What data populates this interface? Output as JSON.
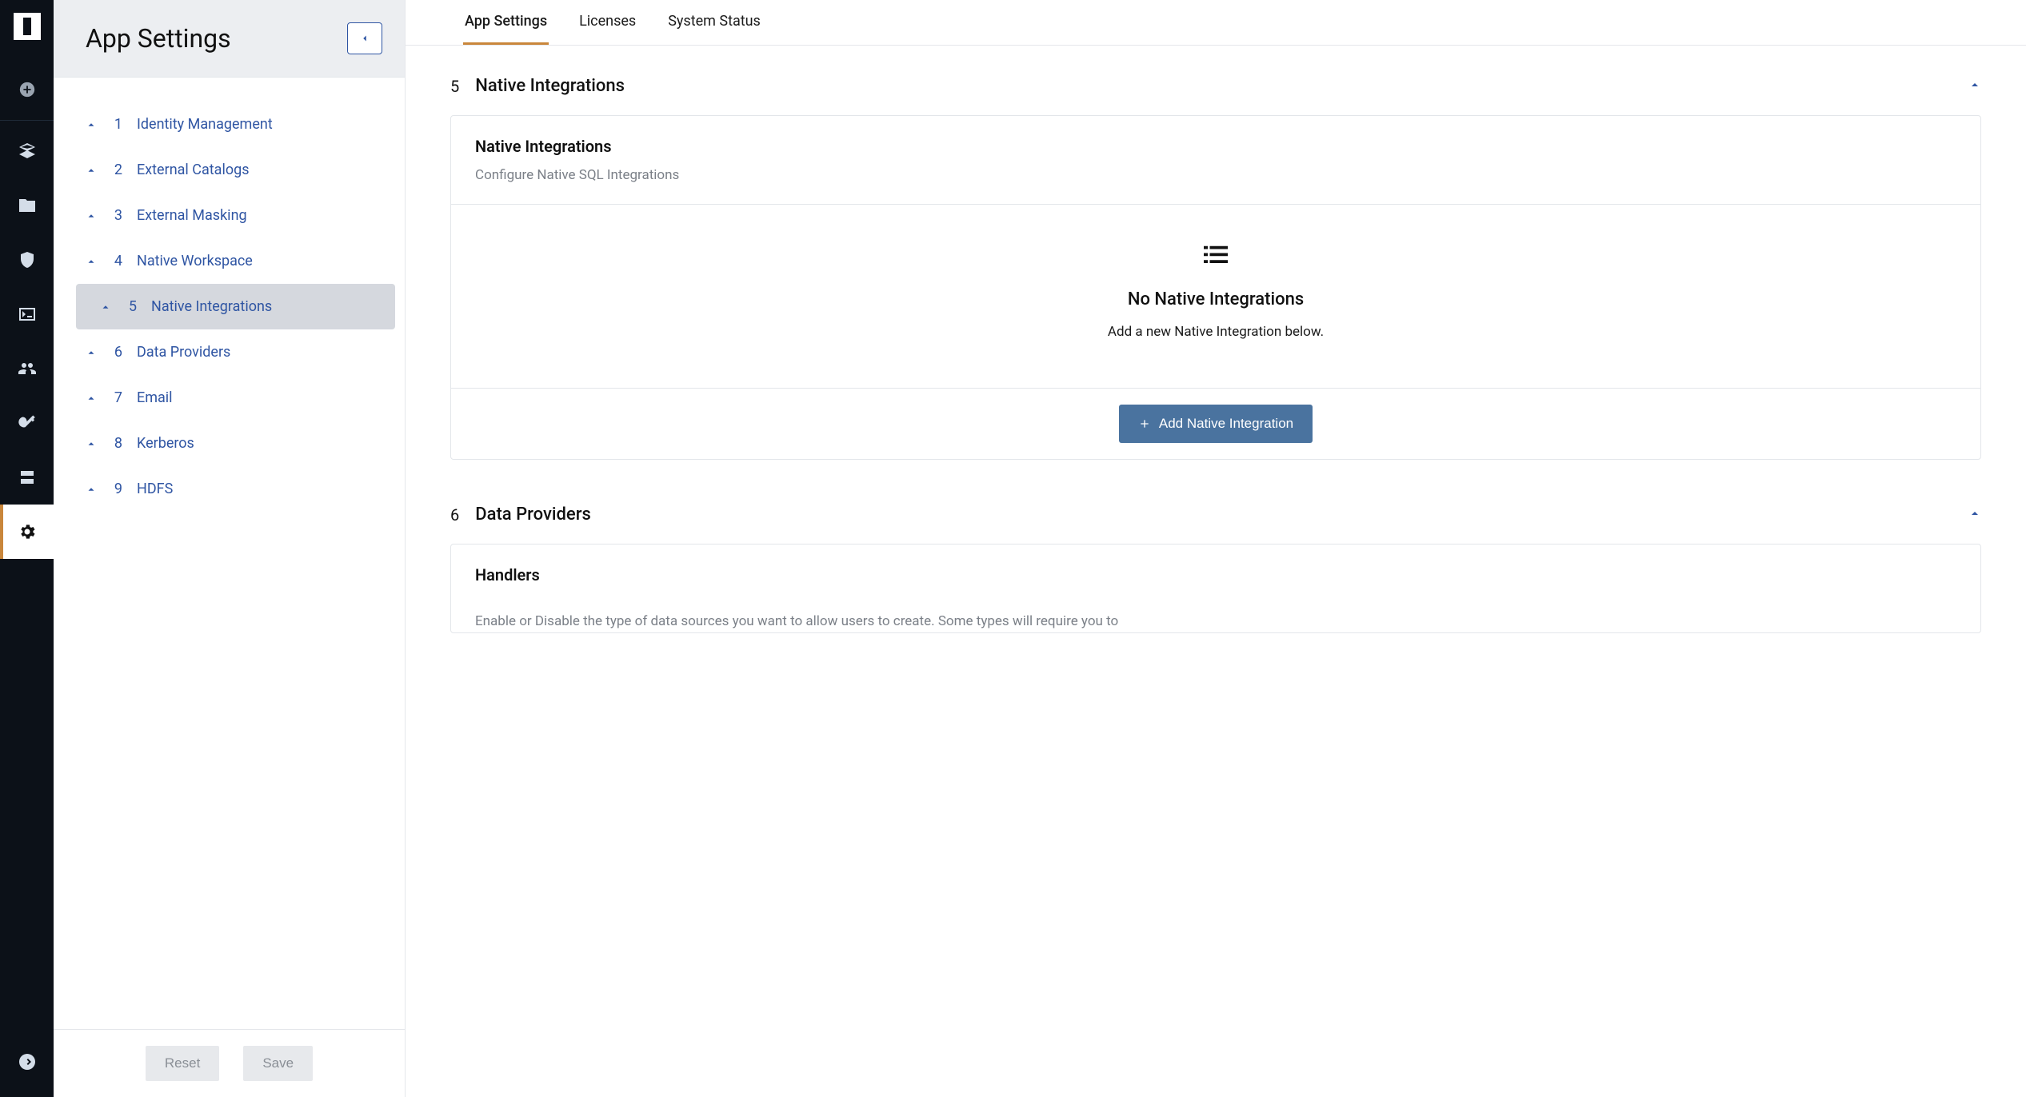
{
  "sidebar": {
    "title": "App Settings",
    "items": [
      {
        "num": "1",
        "label": "Identity Management"
      },
      {
        "num": "2",
        "label": "External Catalogs"
      },
      {
        "num": "3",
        "label": "External Masking"
      },
      {
        "num": "4",
        "label": "Native Workspace"
      },
      {
        "num": "5",
        "label": "Native Integrations"
      },
      {
        "num": "6",
        "label": "Data Providers"
      },
      {
        "num": "7",
        "label": "Email"
      },
      {
        "num": "8",
        "label": "Kerberos"
      },
      {
        "num": "9",
        "label": "HDFS"
      }
    ],
    "footer": {
      "reset": "Reset",
      "save": "Save"
    }
  },
  "tabs": {
    "t0": "App Settings",
    "t1": "Licenses",
    "t2": "System Status"
  },
  "section5": {
    "num": "5",
    "title": "Native Integrations",
    "card_title": "Native Integrations",
    "card_sub": "Configure Native SQL Integrations",
    "empty_title": "No Native Integrations",
    "empty_sub": "Add a new Native Integration below.",
    "add_btn": "Add Native Integration"
  },
  "section6": {
    "num": "6",
    "title": "Data Providers",
    "card_title": "Handlers",
    "card_sub": "Enable or Disable the type of data sources you want to allow users to create. Some types will require you to"
  }
}
